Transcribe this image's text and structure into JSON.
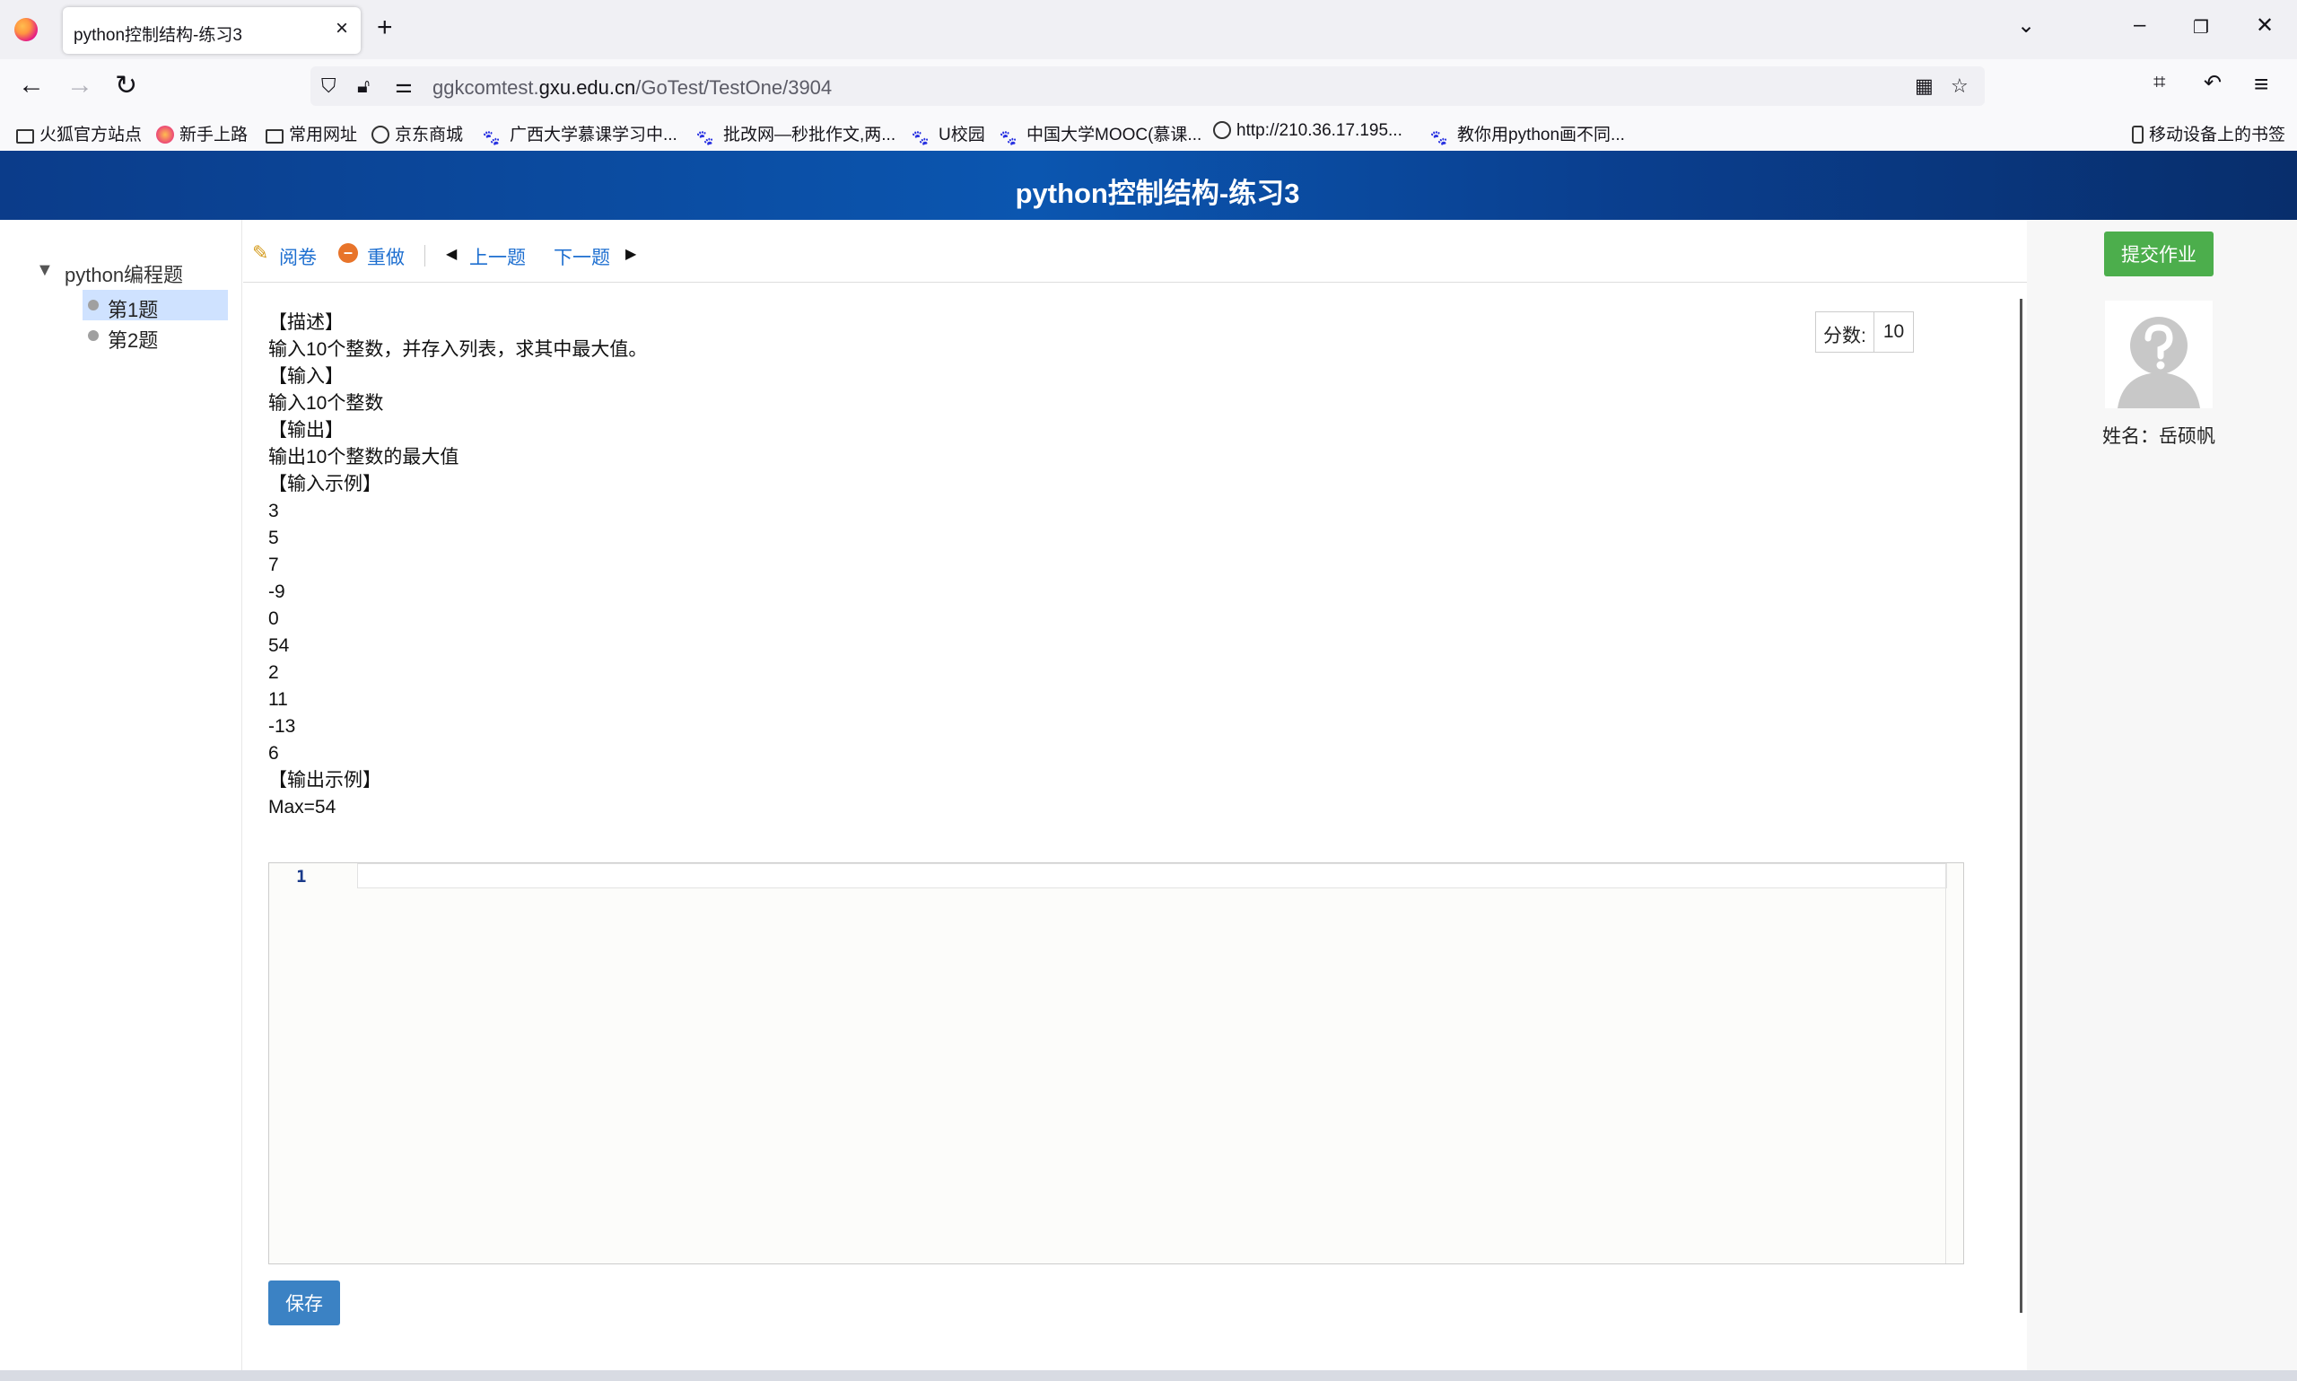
{
  "browser": {
    "tab_title": "python控制结构-练习3",
    "url_prefix": "ggkcomtest.",
    "url_domain": "gxu.edu.cn",
    "url_path": "/GoTest/TestOne/3904"
  },
  "bookmarks": [
    "火狐官方站点",
    "新手上路",
    "常用网址",
    "京东商城",
    "广西大学慕课学习中...",
    "批改网—秒批作文,两...",
    "U校园",
    "中国大学MOOC(慕课...",
    "http://210.36.17.195...",
    "教你用python画不同...",
    "移动设备上的书签"
  ],
  "header": {
    "title": "python控制结构-练习3"
  },
  "tree": {
    "root": "python编程题",
    "items": [
      "第1题",
      "第2题"
    ]
  },
  "toolbar": {
    "review": "阅卷",
    "redo": "重做",
    "prev": "上一题",
    "next": "下一题"
  },
  "question": {
    "lines": [
      "【描述】",
      "输入10个整数，并存入列表，求其中最大值。",
      "【输入】",
      "输入10个整数",
      "【输出】",
      "输出10个整数的最大值",
      "【输入示例】",
      "3",
      "5",
      "7",
      "-9",
      "0",
      "54",
      "2",
      "11",
      "-13",
      "6",
      "【输出示例】",
      "Max=54"
    ],
    "score_label": "分数:",
    "score_value": "10"
  },
  "editor": {
    "line_number": "1"
  },
  "buttons": {
    "save": "保存",
    "submit": "提交作业"
  },
  "user": {
    "name": "姓名：岳硕帆"
  },
  "colors": {
    "header_blue": "#0b56b0",
    "link_blue": "#1e6fd0",
    "submit_green": "#4cae4c",
    "save_blue": "#3b82c4",
    "selected_bg": "#cfe2ff"
  }
}
